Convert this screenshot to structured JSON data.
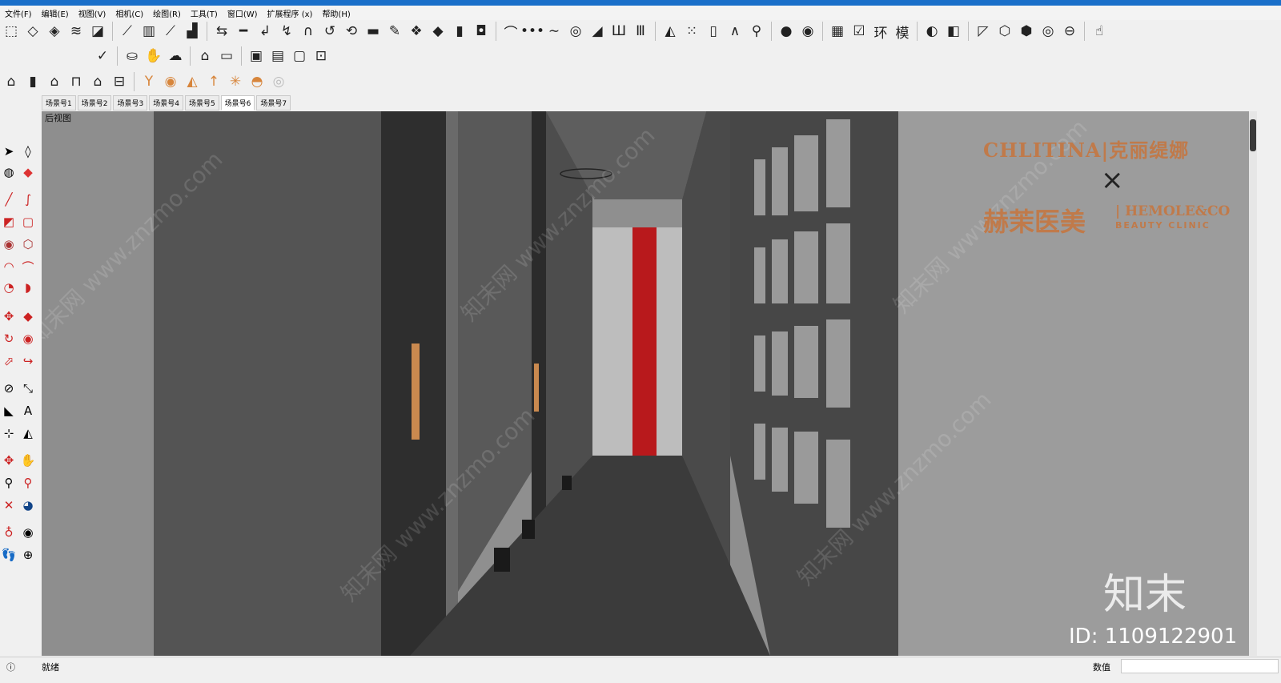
{
  "menu": [
    "文件(F)",
    "编辑(E)",
    "视图(V)",
    "相机(C)",
    "绘图(R)",
    "工具(T)",
    "窗口(W)",
    "扩展程序 (x)",
    "帮助(H)"
  ],
  "scene_tabs": [
    "场景号1",
    "场景号2",
    "场景号3",
    "场景号4",
    "场景号5",
    "场景号6",
    "场景号7"
  ],
  "active_tab": "场景号6",
  "view_label": "后视图",
  "status": {
    "left": "就绪",
    "right_label": "数值"
  },
  "logo": {
    "line1": "CHLITINA|克丽缇娜",
    "x": "×",
    "line2_cn": "赫茉医美",
    "line2_en": "| HEMOLE&CO",
    "line2_sub": "BEAUTY CLINIC"
  },
  "watermark": {
    "big": "知末",
    "id": "ID: 1109122901",
    "diag": "知末网 www.znzmo.com"
  },
  "colors": {
    "accent_red": "#b8191c",
    "logo": "#c07a4a",
    "titlebar": "#1a6fc9"
  },
  "toolbar_icons": {
    "row1": [
      "select-icon",
      "box-icon",
      "box2-icon",
      "sandbox-icon",
      "paint-icon",
      "stairs-icon",
      "ladder-icon",
      "ramp-icon",
      "chart-icon",
      "align-icon",
      "line-icon",
      "arc-icon",
      "curve-icon",
      "spline-icon",
      "loop-icon",
      "offset-icon",
      "plane-icon",
      "pen-icon",
      "stack-icon",
      "layers-icon",
      "cube-icon",
      "shift-icon",
      "arch-icon",
      "dots-icon",
      "wave-icon",
      "spiral-icon",
      "brush-icon",
      "comb-icon",
      "column-icon",
      "triangle-icon",
      "grid-icon",
      "book-icon",
      "compass-icon",
      "broom-icon",
      "circle-icon",
      "circle2-icon",
      "table-icon",
      "check-icon",
      "ring-icon",
      "mold-icon",
      "sphere-icon",
      "group-icon",
      "view1-icon",
      "view2-icon",
      "view3-icon",
      "view4-icon",
      "view5-icon",
      "touch-icon"
    ],
    "row2": [
      "validate-icon",
      "bucket-icon",
      "hand-icon",
      "cloud-icon",
      "roof-icon",
      "frame-icon",
      "window-icon",
      "window2-icon",
      "window3-icon",
      "lock-icon"
    ],
    "row3": [
      "house-icon",
      "wall-icon",
      "home-icon",
      "garage-icon",
      "home2-icon",
      "shop-icon",
      "lamp-icon",
      "sun-icon",
      "cone-icon",
      "umbrella-icon",
      "spark-icon",
      "shell-icon",
      "light-icon"
    ]
  }
}
